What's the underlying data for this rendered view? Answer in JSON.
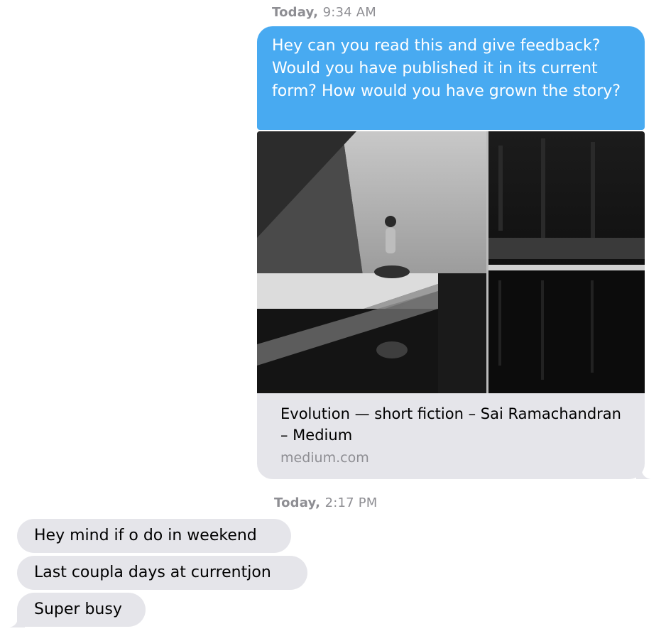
{
  "conversation": {
    "timestamps": [
      {
        "day": "Today,",
        "time": "9:34 AM"
      },
      {
        "day": "Today,",
        "time": "2:17 PM"
      }
    ],
    "sent_message": "Hey can you read this and give feedback? Would you have published it in its current form? How would you have grown the story?",
    "link_preview": {
      "title": "Evolution — short fiction – Sai Ramachandran – Medium",
      "domain": "medium.com"
    },
    "received_messages": [
      "Hey mind if o do in weekend",
      "Last coupla days at currentjon",
      "Super busy"
    ]
  },
  "colors": {
    "sent_bubble": "#48aaf1",
    "received_bubble": "#e5e5ea",
    "timestamp": "#8e8e93"
  }
}
